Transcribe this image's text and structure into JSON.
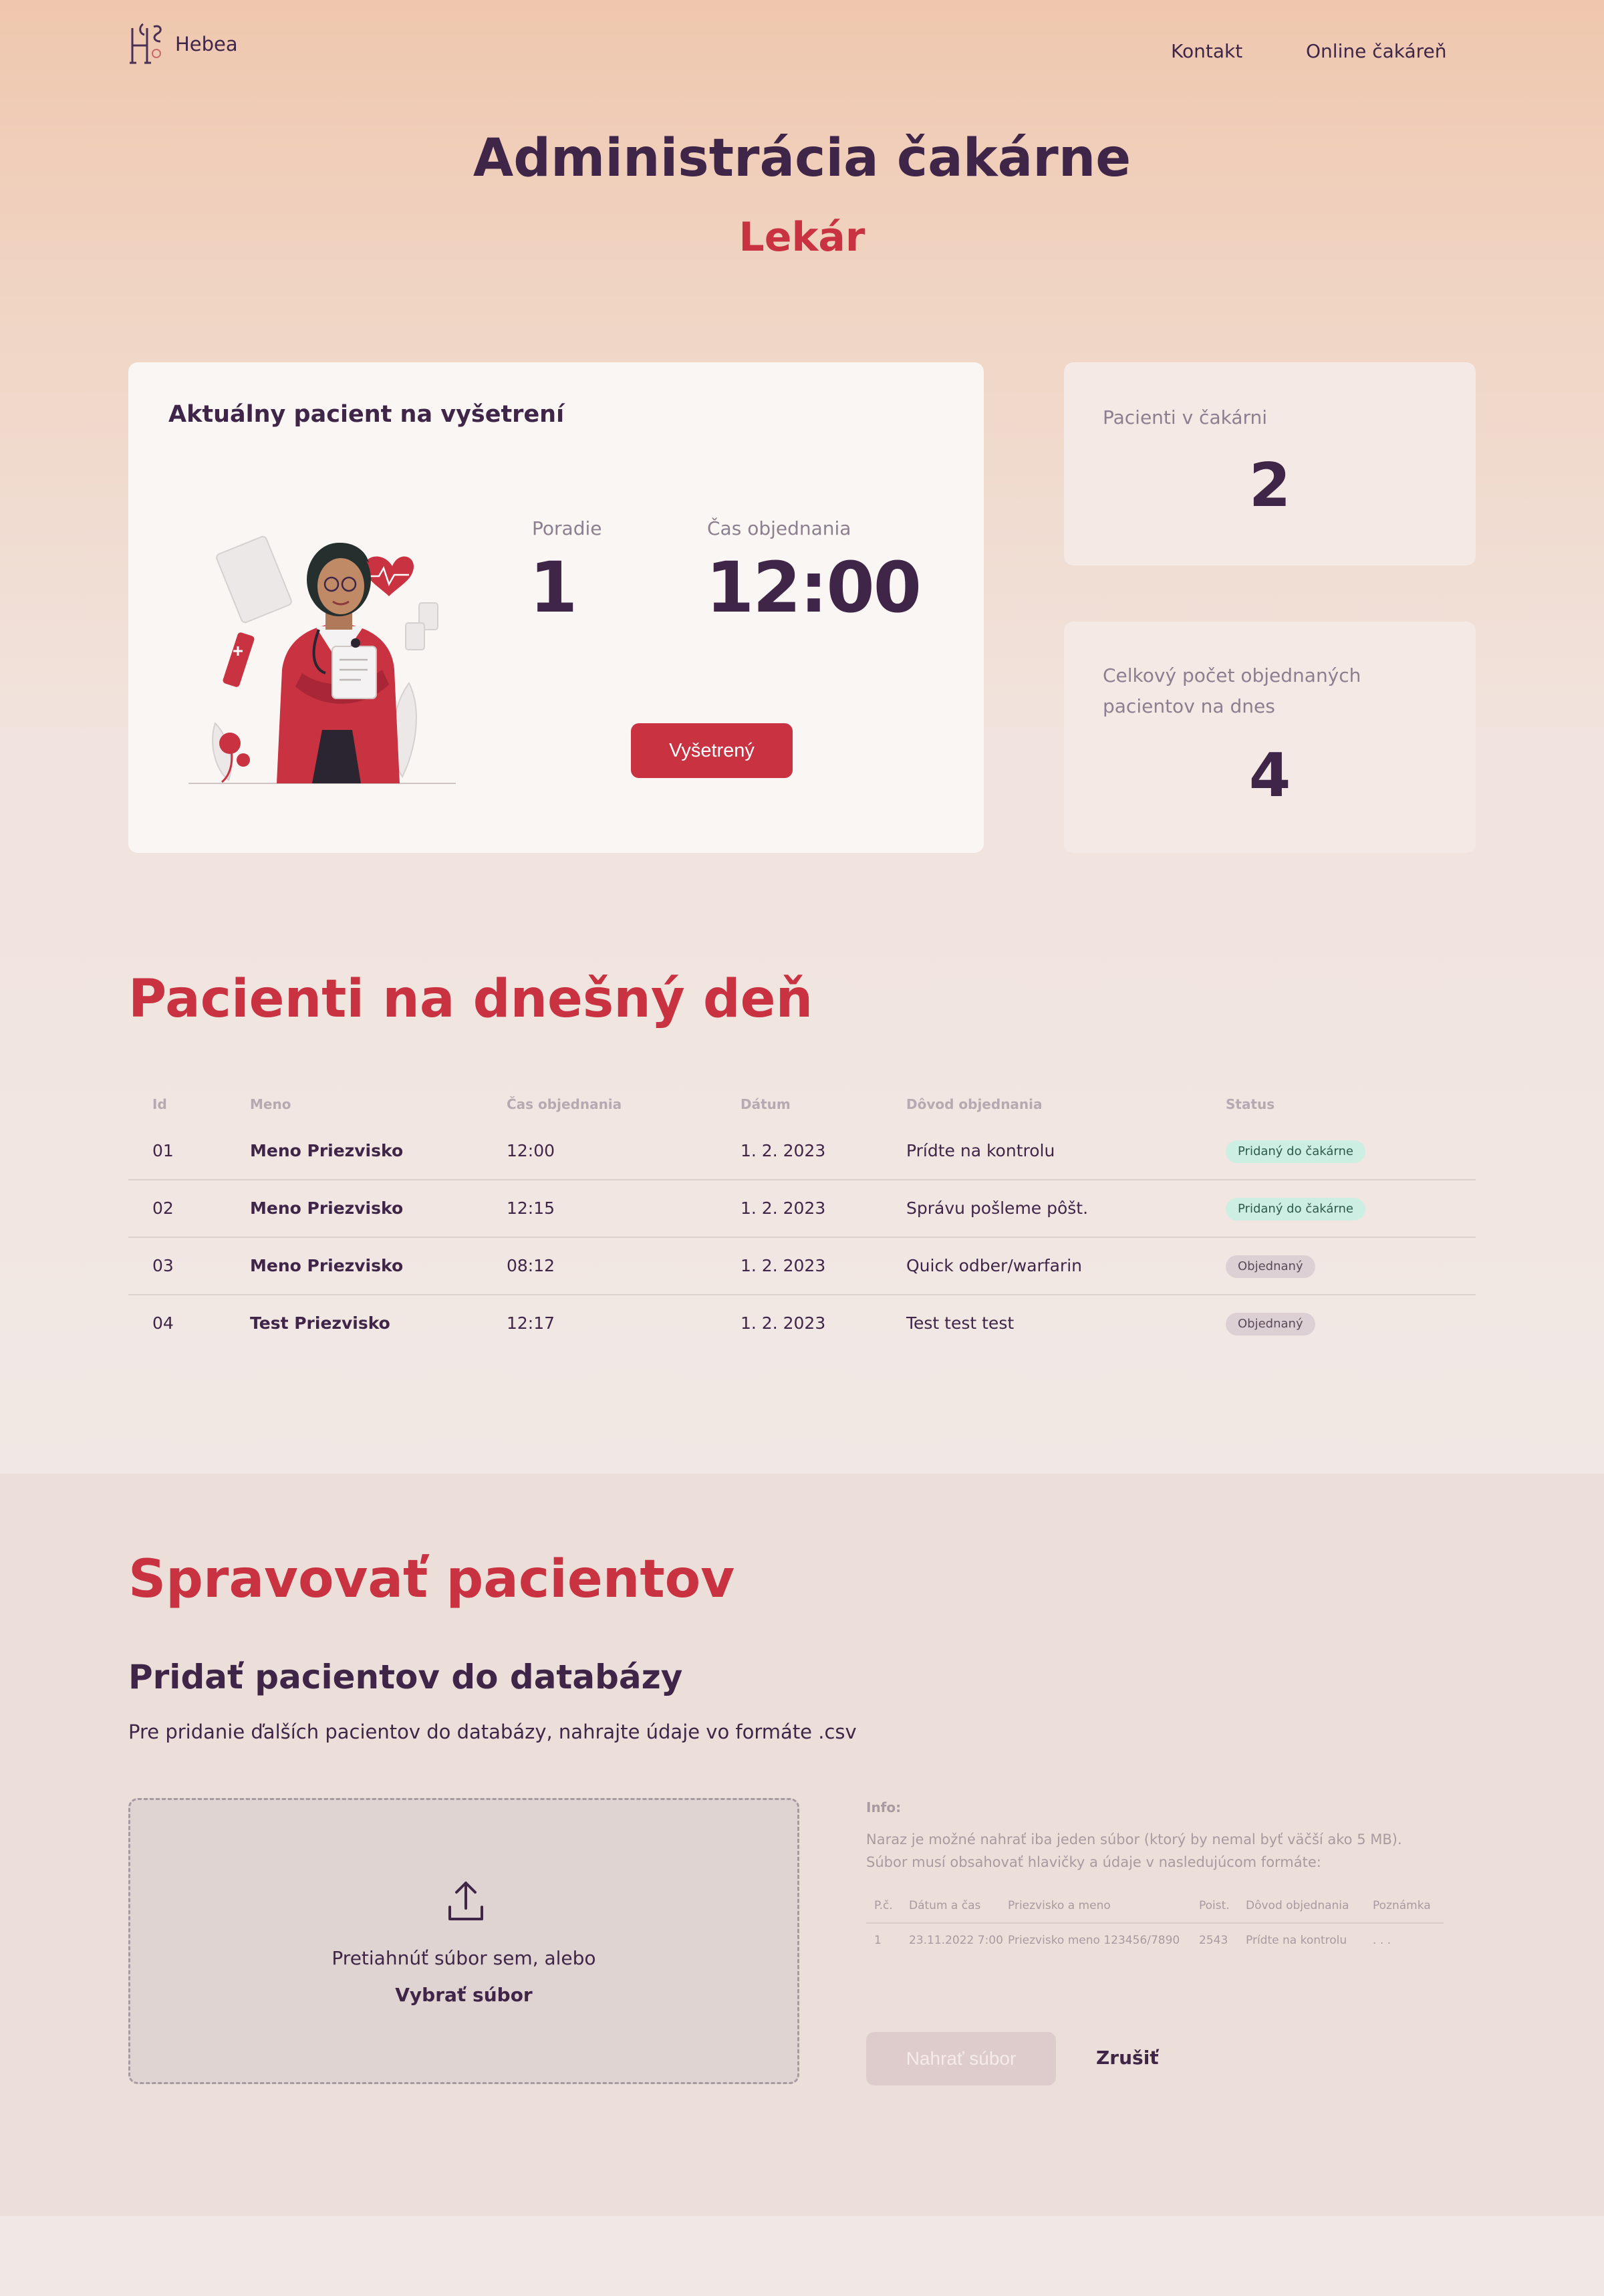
{
  "header": {
    "logo_text": "Hebea",
    "nav": [
      {
        "label": "Kontakt"
      },
      {
        "label": "Online čakáreň"
      }
    ]
  },
  "hero": {
    "title": "Administrácia čakárne",
    "subtitle": "Lekár"
  },
  "current_patient": {
    "title": "Aktuálny pacient na vyšetrení",
    "order_label": "Poradie",
    "order_value": "1",
    "time_label": "Čas objednania",
    "time_value": "12:00",
    "button_label": "Vyšetrený"
  },
  "stats": {
    "waiting_label": "Pacienti v čakárni",
    "waiting_value": "2",
    "total_label": "Celkový počet objednaných pacientov na dnes",
    "total_value": "4"
  },
  "patients_section": {
    "title": "Pacienti na dnešný deň",
    "columns": [
      "Id",
      "Meno",
      "Čas objednania",
      "Dátum",
      "Dôvod objednania",
      "Status"
    ],
    "rows": [
      {
        "id": "01",
        "name": "Meno Priezvisko",
        "time": "12:00",
        "date": "1. 2. 2023",
        "reason": "Prídte na kontrolu",
        "status": "Pridaný do čakárne",
        "status_type": "added"
      },
      {
        "id": "02",
        "name": "Meno Priezvisko",
        "time": "12:15",
        "date": "1. 2. 2023",
        "reason": "Správu pošleme pôšt.",
        "status": "Pridaný do čakárne",
        "status_type": "added"
      },
      {
        "id": "03",
        "name": "Meno Priezvisko",
        "time": "08:12",
        "date": "1. 2. 2023",
        "reason": "Quick odber/warfarin",
        "status": "Objednaný",
        "status_type": "ordered"
      },
      {
        "id": "04",
        "name": "Test Priezvisko",
        "time": "12:17",
        "date": "1. 2. 2023",
        "reason": "Test test test",
        "status": "Objednaný",
        "status_type": "ordered"
      }
    ],
    "status_colors": {
      "added": "#cdeee2",
      "ordered": "#ddd0d4"
    }
  },
  "manage": {
    "title": "Spravovať pacientov",
    "add_title": "Pridať pacientov do databázy",
    "add_desc": "Pre pridanie ďalších pacientov do databázy, nahrajte údaje vo formáte .csv",
    "drop_text": "Pretiahnúť súbor sem, alebo",
    "choose_file": "Vybrať súbor",
    "info_title": "Info:",
    "info_line1": "Naraz je možné nahrať iba jeden súbor (ktorý by nemal byť väčší ako 5 MB).",
    "info_line2": "Súbor musí obsahovať hlavičky a údaje v nasledujúcom formáte:",
    "format_headers": [
      "P.č.",
      "Dátum a čas",
      "Priezvisko a meno",
      "Poist.",
      "Dôvod objednania",
      "Poznámka"
    ],
    "format_row": [
      "1",
      "23.11.2022 7:00",
      "Priezvisko meno 123456/7890",
      "2543",
      "Prídte na kontrolu",
      ". . ."
    ],
    "upload_button": "Nahrať súbor",
    "cancel_button": "Zrušiť"
  },
  "colors": {
    "primary": "#c83241",
    "text_dark": "#3f2648",
    "muted": "#8c7f8f"
  }
}
